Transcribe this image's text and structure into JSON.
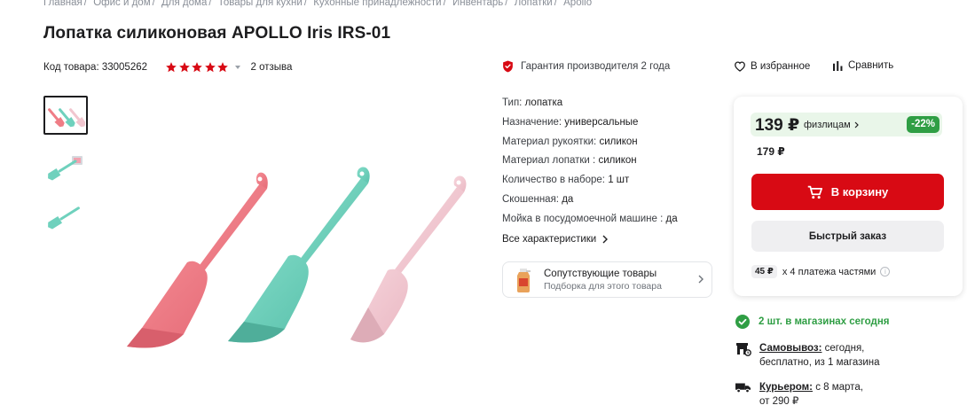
{
  "breadcrumb": [
    "Главная",
    "Офис и дом",
    "Для дома",
    "Товары для кухни",
    "Кухонные принадлежности",
    "Инвентарь",
    "Лопатки",
    "Apollo"
  ],
  "title": "Лопатка силиконовая APOLLO Iris IRS-01",
  "product_code": "Код товара: 33005262",
  "rating": 5,
  "reviews": "2 отзыва",
  "warranty": "Гарантия производителя 2 года",
  "favorite": "В избранное",
  "compare": "Сравнить",
  "specs": [
    {
      "label": "Тип:",
      "value": "лопатка"
    },
    {
      "label": "Назначение:",
      "value": "универсальные"
    },
    {
      "label": "Материал рукоятки:",
      "value": "силикон"
    },
    {
      "label": "Материал лопатки :",
      "value": "силикон"
    },
    {
      "label": "Количество в наборе:",
      "value": "1 шт"
    },
    {
      "label": "Скошенная:",
      "value": "да"
    },
    {
      "label": "Мойка в посудомоечной машине :",
      "value": "да"
    }
  ],
  "all_specs": "Все характеристики",
  "related": {
    "title": "Сопутствующие товары",
    "subtitle": "Подборка для этого товара"
  },
  "price": {
    "current": "139 ₽",
    "label": "физлицам",
    "discount": "-22%",
    "old": "179 ₽",
    "cart_button": "В корзину",
    "quick_order": "Быстрый заказ",
    "installment_amount": "45 ₽",
    "installment_text": "х 4 платежа частями"
  },
  "availability": {
    "stock": "2 шт. в магазинах сегодня",
    "pickup_title": "Самовывоз:",
    "pickup_line1": "сегодня,",
    "pickup_line2": "бесплатно, из 1 магазина",
    "courier_title": "Курьером:",
    "courier_line1": "с 8 марта,",
    "courier_line2": "от 290 ₽"
  },
  "colors": {
    "accent": "#d80a14",
    "green": "#2f9e44",
    "pink": "#ef7d86",
    "mint": "#6fd1bd",
    "light_pink": "#f1c6cf"
  },
  "icons": [
    "shield-icon",
    "heart-icon",
    "compare-icon",
    "cart-icon",
    "check-icon",
    "store-icon",
    "truck-icon"
  ]
}
